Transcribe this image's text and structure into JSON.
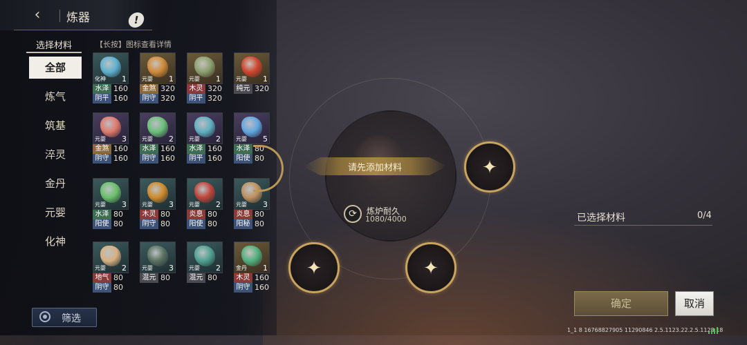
{
  "header": {
    "back_icon": "chevron-left-icon",
    "title": "炼器",
    "info_label": "!"
  },
  "materials": {
    "select_label": "选择材料",
    "hint": "【长按】图标查看详情",
    "categories": [
      "全部",
      "炼气",
      "筑基",
      "淬灵",
      "金丹",
      "元婴",
      "化神"
    ],
    "active_category": "全部",
    "items": [
      {
        "tier": "化神",
        "count": "1",
        "theme": "teal",
        "color": "#5fb0d0",
        "stats": [
          {
            "attr": "水泽",
            "val": "160",
            "bg": "green"
          },
          {
            "attr": "阴平",
            "val": "160",
            "bg": "blue"
          }
        ]
      },
      {
        "tier": "元婴",
        "count": "1",
        "theme": "gold",
        "color": "#d08a3a",
        "stats": [
          {
            "attr": "金煞",
            "val": "320",
            "bg": "gold"
          },
          {
            "attr": "阴守",
            "val": "320",
            "bg": "blue"
          }
        ]
      },
      {
        "tier": "元婴",
        "count": "1",
        "theme": "gold",
        "color": "#8aa070",
        "stats": [
          {
            "attr": "木灵",
            "val": "320",
            "bg": "red"
          },
          {
            "attr": "阴平",
            "val": "320",
            "bg": "blue"
          }
        ]
      },
      {
        "tier": "元婴",
        "count": "1",
        "theme": "gold",
        "color": "#d0442e",
        "stats": [
          {
            "attr": "纯元",
            "val": "320",
            "bg": "gray"
          }
        ]
      },
      {
        "tier": "元婴",
        "count": "3",
        "theme": "purple",
        "color": "#e07a6a",
        "stats": [
          {
            "attr": "金煞",
            "val": "160",
            "bg": "gold"
          },
          {
            "attr": "阴守",
            "val": "160",
            "bg": "blue"
          }
        ]
      },
      {
        "tier": "元婴",
        "count": "2",
        "theme": "purple",
        "color": "#6ac07a",
        "stats": [
          {
            "attr": "水泽",
            "val": "160",
            "bg": "green"
          },
          {
            "attr": "阴守",
            "val": "160",
            "bg": "blue"
          }
        ]
      },
      {
        "tier": "元婴",
        "count": "2",
        "theme": "purple",
        "color": "#5fb0c0",
        "stats": [
          {
            "attr": "水泽",
            "val": "160",
            "bg": "green"
          },
          {
            "attr": "阴平",
            "val": "160",
            "bg": "blue"
          }
        ]
      },
      {
        "tier": "元婴",
        "count": "5",
        "theme": "purple",
        "color": "#60a8e0",
        "stats": [
          {
            "attr": "水泽",
            "val": "80",
            "bg": "green"
          },
          {
            "attr": "阳使",
            "val": "80",
            "bg": "blue"
          }
        ]
      },
      {
        "tier": "元婴",
        "count": "3",
        "theme": "teal",
        "color": "#6ac06a",
        "stats": [
          {
            "attr": "水泽",
            "val": "80",
            "bg": "green"
          },
          {
            "attr": "阳使",
            "val": "80",
            "bg": "blue"
          }
        ]
      },
      {
        "tier": "元婴",
        "count": "3",
        "theme": "teal",
        "color": "#d08a2a",
        "stats": [
          {
            "attr": "木灵",
            "val": "80",
            "bg": "red"
          },
          {
            "attr": "阴守",
            "val": "80",
            "bg": "blue"
          }
        ]
      },
      {
        "tier": "元婴",
        "count": "2",
        "theme": "teal",
        "color": "#c0443a",
        "stats": [
          {
            "attr": "炎息",
            "val": "80",
            "bg": "red"
          },
          {
            "attr": "阳使",
            "val": "80",
            "bg": "blue"
          }
        ]
      },
      {
        "tier": "元婴",
        "count": "3",
        "theme": "teal",
        "color": "#c09060",
        "stats": [
          {
            "attr": "炎息",
            "val": "80",
            "bg": "red"
          },
          {
            "attr": "阳秘",
            "val": "80",
            "bg": "blue"
          }
        ]
      },
      {
        "tier": "元婴",
        "count": "2",
        "theme": "teal",
        "color": "#d8b080",
        "stats": [
          {
            "attr": "地气",
            "val": "80",
            "bg": "red"
          },
          {
            "attr": "阴守",
            "val": "80",
            "bg": "blue"
          }
        ]
      },
      {
        "tier": "元婴",
        "count": "3",
        "theme": "teal",
        "color": "#5a7060",
        "stats": [
          {
            "attr": "混元",
            "val": "80",
            "bg": "gray"
          }
        ]
      },
      {
        "tier": "元婴",
        "count": "2",
        "theme": "teal",
        "color": "#50a090",
        "stats": [
          {
            "attr": "混元",
            "val": "80",
            "bg": "gray"
          }
        ]
      },
      {
        "tier": "金丹",
        "count": "1",
        "theme": "gold",
        "color": "#50b080",
        "stats": [
          {
            "attr": "木灵",
            "val": "160",
            "bg": "red"
          },
          {
            "attr": "阴守",
            "val": "160",
            "bg": "blue"
          }
        ]
      }
    ],
    "filter_label": "筛选",
    "filter_icon": "filter-icon"
  },
  "furnace": {
    "banner_text": "请先添加材料",
    "durability_label": "炼炉耐久",
    "durability_value": "1080/4000",
    "durability_icon": "refresh-icon",
    "slot_icon": "plus-sparkle-icon"
  },
  "selection": {
    "chosen_label": "已选择材料",
    "chosen_count": "0/4",
    "confirm_label": "确定",
    "cancel_label": "取消"
  },
  "status_bar": {
    "text": "1_1 8 16768827905 11290846 2.5.1123.22.2.5.1128.18",
    "signal_icon": "signal-icon"
  }
}
